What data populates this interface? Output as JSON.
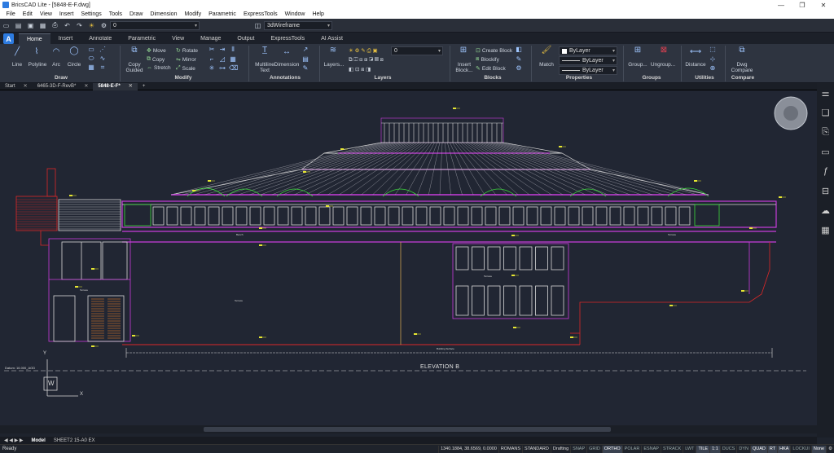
{
  "titlebar": {
    "title": "BricsCAD Lite - [5848-E-F.dwg]",
    "minimize": "—",
    "restore": "❐",
    "close": "✕"
  },
  "menu": [
    "File",
    "Edit",
    "View",
    "Insert",
    "Settings",
    "Tools",
    "Draw",
    "Dimension",
    "Modify",
    "Parametric",
    "ExpressTools",
    "Window",
    "Help"
  ],
  "qat": {
    "layer_value": "0",
    "visual_style": "3dWireframe"
  },
  "ribbon_tabs": [
    "Home",
    "Insert",
    "Annotate",
    "Parametric",
    "View",
    "Manage",
    "Output",
    "ExpressTools",
    "AI Assist"
  ],
  "ribbon": {
    "draw": {
      "line": "Line",
      "polyline": "Polyline",
      "arc": "Arc",
      "circle": "Circle",
      "panel": "Draw"
    },
    "modify": {
      "copy_guided": "Copy Guided",
      "move": "Move",
      "copy": "Copy",
      "stretch": "Stretch",
      "rotate": "Rotate",
      "mirror": "Mirror",
      "scale": "Scale",
      "panel": "Modify"
    },
    "annotations": {
      "multiline_text": "Multiline Text",
      "dimension": "Dimension",
      "panel": "Annotations"
    },
    "layers": {
      "layers": "Layers...",
      "layer_value": "0",
      "panel": "Layers"
    },
    "blocks": {
      "insert_block": "Insert Block...",
      "create_block": "Create Block",
      "blockify": "Blockify",
      "edit_block": "Edit Block",
      "panel": "Blocks"
    },
    "properties": {
      "match": "Match",
      "color": "ByLayer",
      "linetype": "ByLayer",
      "lineweight": "ByLayer",
      "panel": "Properties"
    },
    "groups": {
      "group": "Group...",
      "ungroup": "Ungroup...",
      "panel": "Groups"
    },
    "utilities": {
      "distance": "Distance",
      "panel": "Utilities"
    },
    "compare": {
      "dwg_compare": "Dwg Compare",
      "panel": "Compare"
    }
  },
  "doc_tabs": [
    {
      "label": "Start"
    },
    {
      "label": "6465-3D-F-RevB*"
    },
    {
      "label": "5848-E-F*"
    }
  ],
  "drawing": {
    "elevation_title": "ELEVATION B",
    "datum_label": "Datum: 16.000_AOD",
    "ucs_y": "Y",
    "ucs_w": "W",
    "ucs_x": "X",
    "room_labels": [
      "Terrace",
      "Bench",
      "Terrace",
      "Terrace",
      "Terrace",
      "Building Surface"
    ]
  },
  "layout_tabs": [
    {
      "label": "Model"
    },
    {
      "label": "SHEET2 15-A0 EX"
    }
  ],
  "status": {
    "ready": "Ready",
    "coords": "1340.1884, 38.6569, 0.0000",
    "font": "ROMANS",
    "dimstyle": "STANDARD",
    "workspace": "Drafting",
    "toggles": [
      {
        "label": "SNAP",
        "on": false
      },
      {
        "label": "GRID",
        "on": false
      },
      {
        "label": "ORTHO",
        "on": true
      },
      {
        "label": "POLAR",
        "on": false
      },
      {
        "label": "ESNAP",
        "on": false
      },
      {
        "label": "STRACK",
        "on": false
      },
      {
        "label": "LWT",
        "on": false
      },
      {
        "label": "TILE",
        "on": true
      },
      {
        "label": "1:1",
        "on": true
      },
      {
        "label": "DUCS",
        "on": false
      },
      {
        "label": "DYN",
        "on": false
      },
      {
        "label": "QUAD",
        "on": true
      },
      {
        "label": "RT",
        "on": true
      },
      {
        "label": "HKA",
        "on": true
      },
      {
        "label": "LOCKUI",
        "on": false
      },
      {
        "label": "None",
        "on": true
      }
    ]
  },
  "colors": {
    "canvas": "#212633",
    "magenta": "#c83cdc",
    "white": "#d8d8d8",
    "yellow": "#e6e632",
    "green": "#3cdc3c",
    "red": "#dc2828",
    "cyan": "#32c8dc"
  }
}
